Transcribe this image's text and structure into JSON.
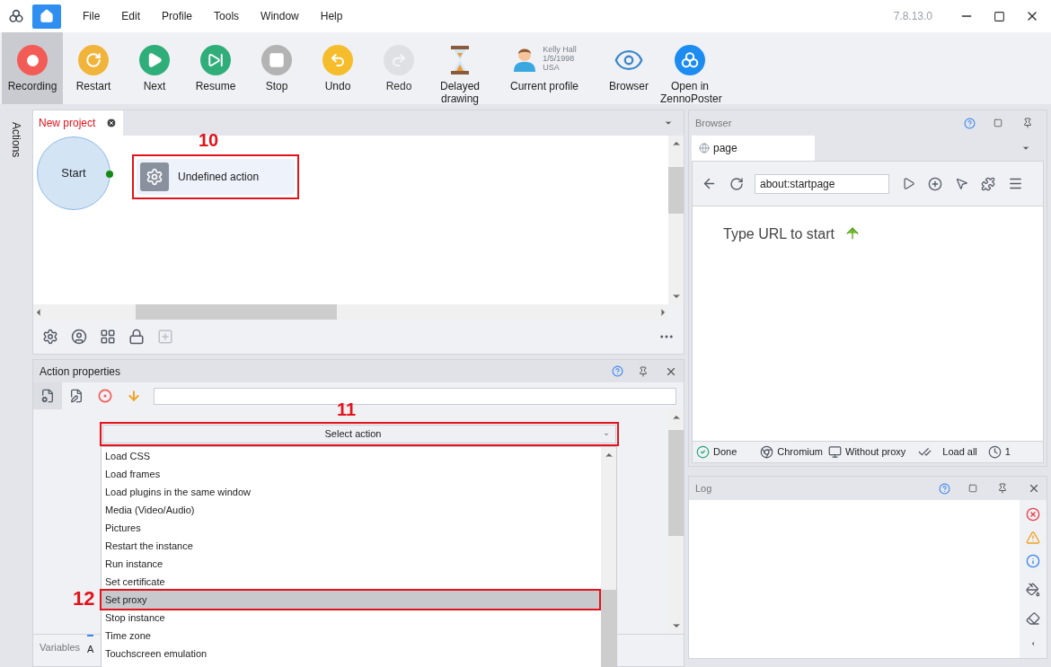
{
  "app": {
    "version": "7.8.13.0"
  },
  "menu": [
    "File",
    "Edit",
    "Profile",
    "Tools",
    "Window",
    "Help"
  ],
  "toolbar": [
    {
      "kind": "record",
      "label": "Recording",
      "selected": true,
      "disabled": false
    },
    {
      "kind": "restart",
      "label": "Restart",
      "selected": false,
      "disabled": false
    },
    {
      "kind": "next",
      "label": "Next",
      "selected": false,
      "disabled": false
    },
    {
      "kind": "resume",
      "label": "Resume",
      "selected": false,
      "disabled": false
    },
    {
      "kind": "stop",
      "label": "Stop",
      "selected": false,
      "disabled": false
    },
    {
      "kind": "undo",
      "label": "Undo",
      "selected": false,
      "disabled": false
    },
    {
      "kind": "redo",
      "label": "Redo",
      "selected": false,
      "disabled": true
    },
    {
      "kind": "delayed",
      "label": "Delayed drawing",
      "selected": false,
      "disabled": false
    },
    {
      "kind": "profile",
      "label": "Current profile",
      "name": "Kelly Hall",
      "birth": "1/5/1998",
      "country": "USA",
      "selected": false,
      "disabled": false
    },
    {
      "kind": "browser",
      "label": "Browser",
      "selected": false,
      "disabled": false
    },
    {
      "kind": "open",
      "label": "Open in ZennoPoster",
      "selected": false,
      "disabled": false
    }
  ],
  "side_strip": {
    "label": "Actions"
  },
  "project": {
    "tabs": [
      {
        "label": "New project",
        "selected": true
      }
    ],
    "nodes": [
      {
        "kind": "start",
        "label": "Start"
      },
      {
        "kind": "action",
        "label": "Undefined action",
        "annotation": "10"
      }
    ]
  },
  "action_properties": {
    "title": "Action properties",
    "select": {
      "value": "Select action",
      "annotation": "11"
    },
    "options": [
      {
        "label": "Load CSS",
        "selected": false
      },
      {
        "label": "Load frames",
        "selected": false
      },
      {
        "label": "Load plugins in the same window",
        "selected": false
      },
      {
        "label": "Media (Video/Audio)",
        "selected": false
      },
      {
        "label": "Pictures",
        "selected": false
      },
      {
        "label": "Restart the instance",
        "selected": false
      },
      {
        "label": "Run instance",
        "selected": false
      },
      {
        "label": "Set certificate",
        "selected": false
      },
      {
        "label": "Set proxy",
        "selected": true,
        "annotation": "12"
      },
      {
        "label": "Stop instance",
        "selected": false
      },
      {
        "label": "Time zone",
        "selected": false
      },
      {
        "label": "Touchscreen emulation",
        "selected": false
      }
    ],
    "bottom_tabs": [
      {
        "label": "Variables",
        "selected": false
      },
      {
        "label": "A",
        "selected": true
      }
    ]
  },
  "browser": {
    "title": "Browser",
    "tab": "page",
    "url": "about:startpage",
    "message": "Type URL to start",
    "status": [
      {
        "kind": "done",
        "label": "Done"
      },
      {
        "kind": "engine",
        "label": "Chromium"
      },
      {
        "kind": "proxy",
        "label": "Without proxy"
      },
      {
        "kind": "load",
        "label": "Load all"
      },
      {
        "kind": "clock",
        "label": "1"
      }
    ]
  },
  "log": {
    "title": "Log"
  }
}
